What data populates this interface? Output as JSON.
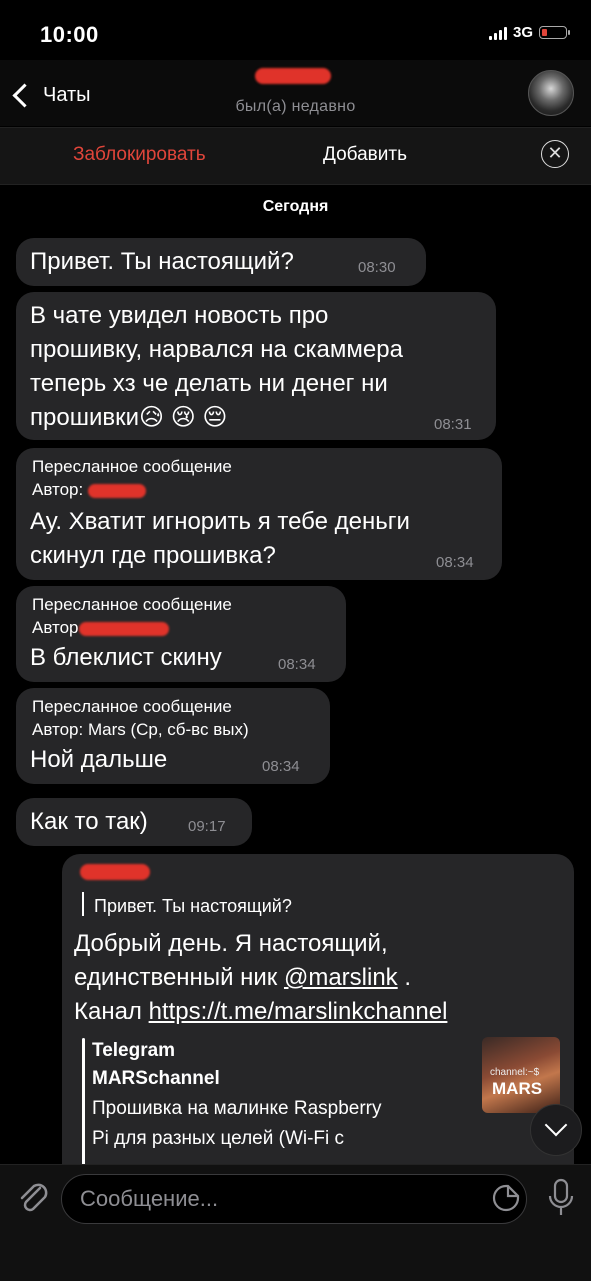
{
  "status_bar": {
    "time": "10:00",
    "network": "3G"
  },
  "header": {
    "back_label": "Чаты",
    "last_seen": "был(а) недавно"
  },
  "action_bar": {
    "block_label": "Заблокировать",
    "add_label": "Добавить",
    "close_symbol": "✕"
  },
  "date_separator": "Сегодня",
  "messages": [
    {
      "text": "Привет. Ты настоящий?",
      "time": "08:30"
    },
    {
      "lines": [
        "В чате увидел новость про",
        "прошивку, нарвался на скаммера",
        "теперь хз че делать ни денег ни",
        "прошивки😥 😢 😔"
      ],
      "time": "08:31"
    },
    {
      "forwarded": "Пересланное сообщение",
      "author_prefix": "Автор:",
      "lines": [
        "Ау. Хватит игнорить я тебе деньги",
        "скинул где прошивка?"
      ],
      "time": "08:34"
    },
    {
      "forwarded": "Пересланное сообщение",
      "author_prefix": "Автор",
      "text": "В блеклист скину",
      "time": "08:34"
    },
    {
      "forwarded": "Пересланное сообщение",
      "author": "Автор: Mars (Ср, сб-вс вых)",
      "text": "Ной дальше",
      "time": "08:34"
    },
    {
      "text": "Как то так)",
      "time": "09:17"
    }
  ],
  "reply_message": {
    "quoted": "Привет. Ты настоящий?",
    "line1": "Добрый день. Я настоящий,",
    "line2_prefix": "единственный ник ",
    "mention": "@marslink",
    "line2_suffix": " .",
    "line3_prefix": "Канал ",
    "link": "https://t.me/marslinkchannel",
    "preview": {
      "site": "Telegram",
      "title": "MARSchannel",
      "desc1": "Прошивка на малинке Raspberry",
      "desc2": "Pi для разных целей (Wi-Fi с",
      "thumb_line1": "channel:~$",
      "thumb_line2": "MARS"
    }
  },
  "input": {
    "placeholder": "Сообщение..."
  },
  "icons": [
    "chevron-left-icon",
    "close-icon",
    "attach-icon",
    "sticker-icon",
    "microphone-icon",
    "chevron-down-icon"
  ],
  "colors": {
    "accent_red": "#e0453a",
    "bubble": "#262628",
    "muted": "#8e8e93"
  }
}
